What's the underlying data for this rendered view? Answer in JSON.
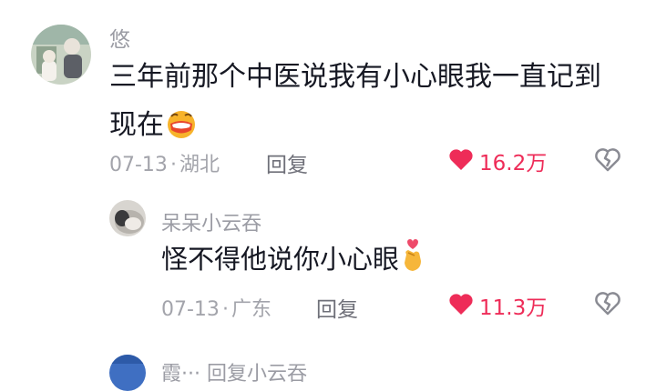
{
  "comments": [
    {
      "username": "悠",
      "text_line1": "三年前那个中医说我有小心眼我一直记到",
      "text_line2": "现在",
      "emoji": "grinning-face-emoji",
      "date": "07-13",
      "location": "湖北",
      "reply_label": "回复",
      "likes": "16.2万"
    },
    {
      "username": "呆呆小云吞",
      "text": "怪不得他说你小心眼",
      "emoji": "finger-heart-emoji",
      "date": "07-13",
      "location": "广东",
      "reply_label": "回复",
      "likes": "11.3万"
    }
  ],
  "third_comment": {
    "username_partial": "霞··· 回复小云吞"
  },
  "colors": {
    "like": "#ee2c58",
    "meta": "#a3a4ab",
    "username": "#9b9ca4"
  },
  "meta_separator": "·"
}
